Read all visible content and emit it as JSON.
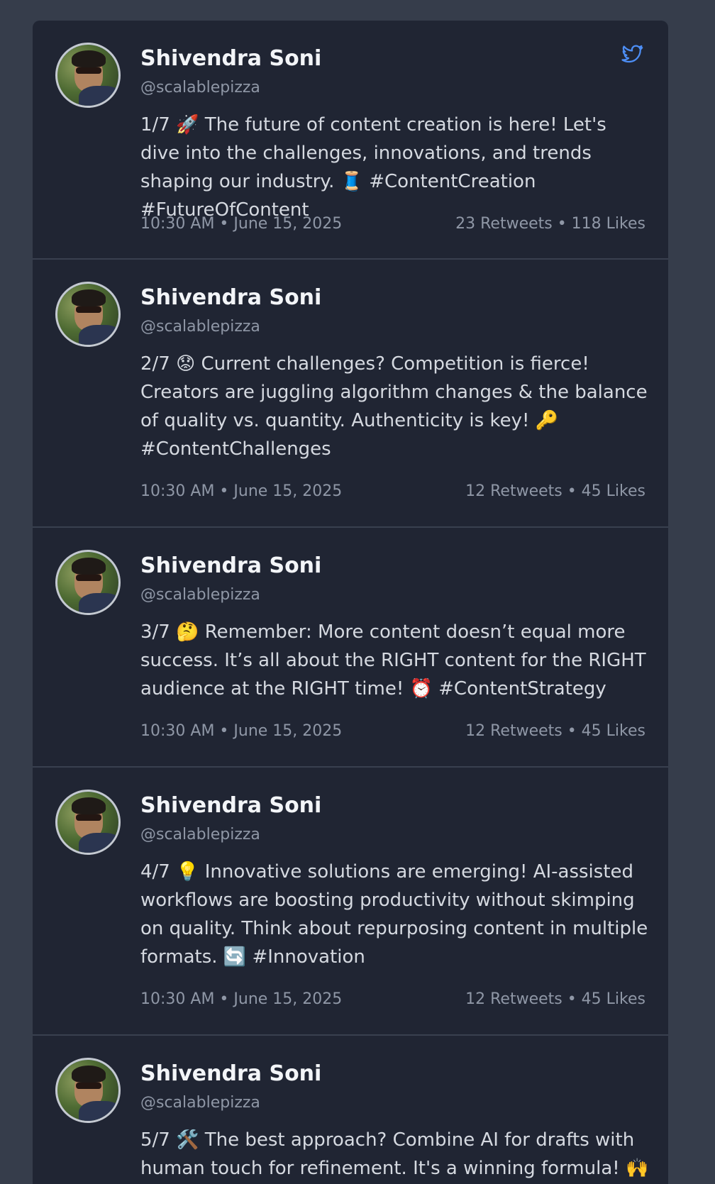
{
  "tweets": [
    {
      "author": "Shivendra Soni",
      "handle": "@scalablepizza",
      "text": "1/7 🚀 The future of content creation is here! Let's dive into the challenges, innovations, and trends shaping our industry. 🧵 #ContentCreation #FutureOfContent",
      "time": "10:30 AM • June 15, 2025",
      "stats": "23 Retweets • 118 Likes"
    },
    {
      "author": "Shivendra Soni",
      "handle": "@scalablepizza",
      "text": "2/7 😟 Current challenges? Competition is fierce! Creators are juggling algorithm changes & the balance of quality vs. quantity. Authenticity is key! 🔑 #ContentChallenges",
      "time": "10:30 AM • June 15, 2025",
      "stats": "12 Retweets • 45 Likes"
    },
    {
      "author": "Shivendra Soni",
      "handle": "@scalablepizza",
      "text": "3/7 🤔 Remember: More content doesn’t equal more success. It’s all about the RIGHT content for the RIGHT audience at the RIGHT time! ⏰ #ContentStrategy",
      "time": "10:30 AM • June 15, 2025",
      "stats": "12 Retweets • 45 Likes"
    },
    {
      "author": "Shivendra Soni",
      "handle": "@scalablepizza",
      "text": "4/7 💡 Innovative solutions are emerging! AI-assisted workflows are boosting productivity without skimping on quality. Think about repurposing content in multiple formats. 🔄 #Innovation",
      "time": "10:30 AM • June 15, 2025",
      "stats": "12 Retweets • 45 Likes"
    },
    {
      "author": "Shivendra Soni",
      "handle": "@scalablepizza",
      "text": "5/7 🛠️ The best approach? Combine AI for drafts with human touch for refinement. It's a winning formula! 🙌",
      "time": "",
      "stats": ""
    }
  ],
  "icons": {
    "brand": "twitter-bird-icon"
  },
  "colors": {
    "page_bg": "#363d4b",
    "card_bg": "#202533",
    "brand_blue": "#4d8ef5",
    "text_primary": "#f3f5f8",
    "text_secondary": "#8f97a6"
  }
}
